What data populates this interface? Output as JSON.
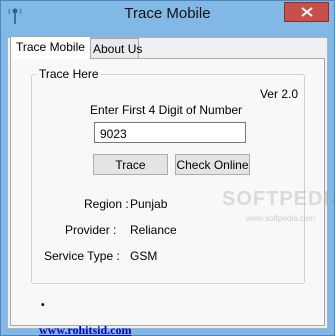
{
  "window": {
    "title": "Trace Mobile",
    "icon": "antenna-icon",
    "close_icon": "close-icon"
  },
  "tabs": [
    {
      "label": "Trace Mobile",
      "active": true
    },
    {
      "label": "About Us",
      "active": false
    }
  ],
  "trace": {
    "group_title": "Trace Here",
    "version": "Ver 2.0",
    "prompt": "Enter First 4 Digit of Number",
    "number_value": "9023",
    "trace_label": "Trace",
    "check_online_label": "Check Online"
  },
  "result": {
    "region_label": "Region :",
    "region_value": "Punjab",
    "provider_label": "Provider :",
    "provider_value": "Reliance",
    "service_label": "Service Type :",
    "service_value": "GSM"
  },
  "footer": {
    "marker": "•",
    "link": "www.rohitsid.com"
  },
  "watermark": {
    "text": "SOFTPEDIA",
    "small_text": "www.softpedia.com"
  },
  "colors": {
    "window_bg": "#82b8e6",
    "close_button": "#c7504b",
    "link": "#0000cc"
  }
}
